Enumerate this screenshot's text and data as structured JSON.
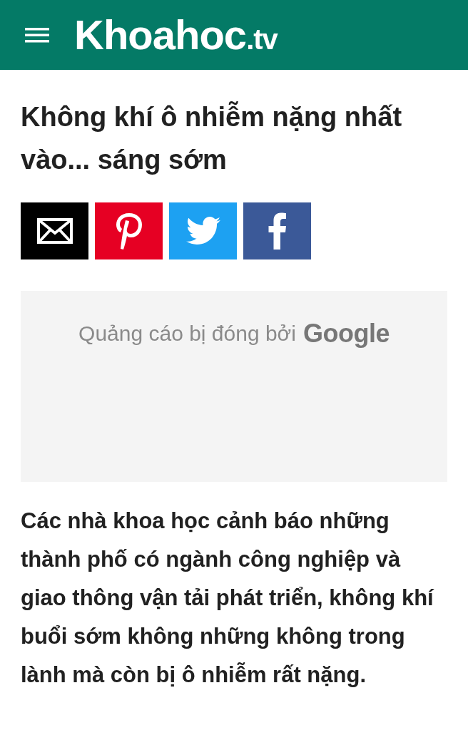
{
  "header": {
    "logo": {
      "name": "Khoahoc",
      "suffix": ".tv"
    }
  },
  "article": {
    "title": "Không khí ô nhiễm nặng nhất vào... sáng sớm",
    "share_buttons": [
      {
        "kind": "email"
      },
      {
        "kind": "pinterest"
      },
      {
        "kind": "twitter"
      },
      {
        "kind": "facebook"
      }
    ],
    "ad": {
      "message": "Quảng cáo bị đóng bởi",
      "brand": "Google"
    },
    "lead": "Các nhà khoa học cảnh báo những thành phố có ngành công nghiệp và giao thông vận tải phát triển, không khí buổi sớm không những không trong lành mà còn bị ô nhiễm rất nặng."
  }
}
